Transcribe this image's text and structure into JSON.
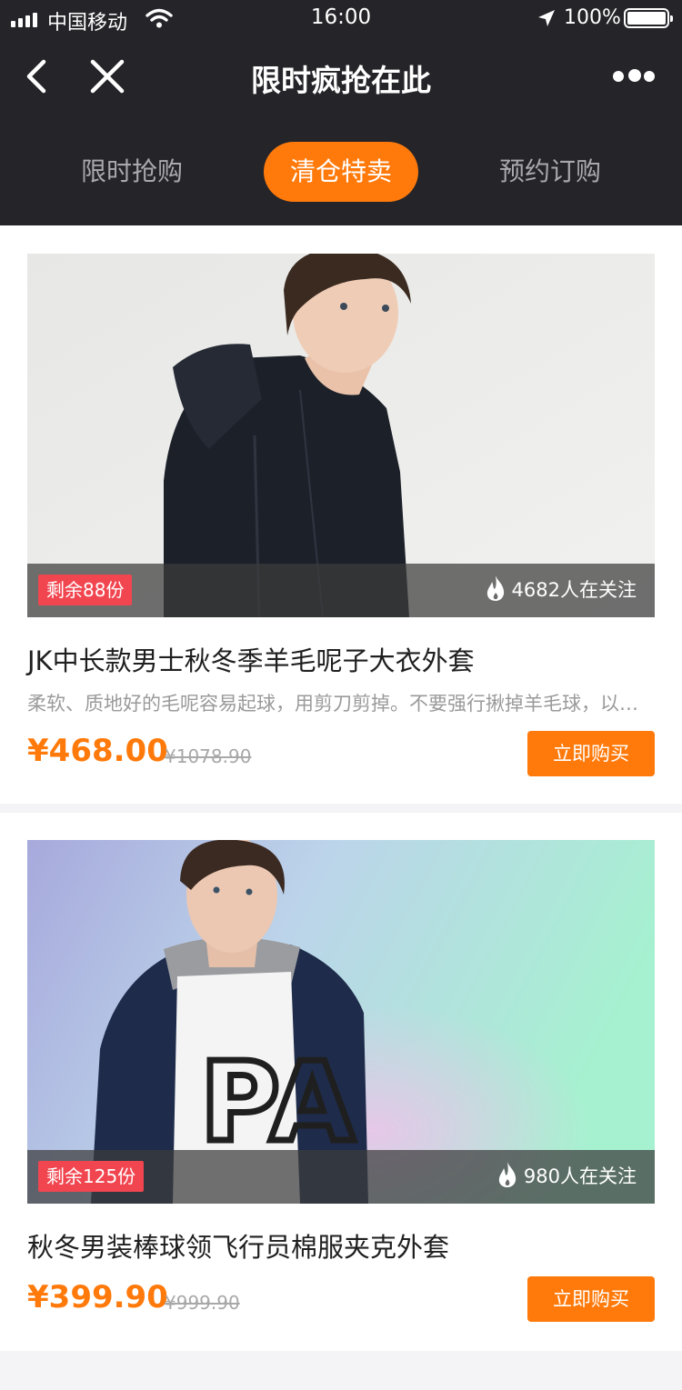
{
  "status_bar": {
    "carrier": "中国移动",
    "time": "16:00",
    "battery": "100%",
    "battery_level": 1.0,
    "icons": [
      "signal-icon",
      "wifi-icon",
      "location-arrow-icon",
      "battery-icon"
    ]
  },
  "nav": {
    "title": "限时疯抢在此",
    "icons": [
      "back-icon",
      "close-icon",
      "more-icon"
    ]
  },
  "tabs": [
    {
      "label": "限时抢购",
      "active": false
    },
    {
      "label": "清仓特卖",
      "active": true
    },
    {
      "label": "预约订购",
      "active": false
    }
  ],
  "products": [
    {
      "stock": "剩余88份",
      "watchers": "4682人在关注",
      "title": "JK中长款男士秋冬季羊毛呢子大衣外套",
      "desc": "柔软、质地好的毛呢容易起球，用剪刀剪掉。不要强行揪掉羊毛球，以免破坏衣物",
      "price": "¥468.00",
      "orig_price": "¥1078.90",
      "buy_label": "立即购买"
    },
    {
      "stock": "剩余125份",
      "watchers": "980人在关注",
      "title": "秋冬男装棒球领飞行员棉服夹克外套",
      "price": "¥399.90",
      "orig_price": "¥999.90",
      "buy_label": "立即购买"
    }
  ],
  "colors": {
    "header_bg": "#242429",
    "accent": "#ff7a0b",
    "stock_badge": "#f14650",
    "page_bg": "#f4f4f6"
  }
}
